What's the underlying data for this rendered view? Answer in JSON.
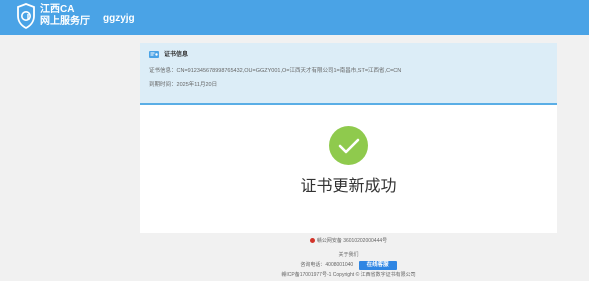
{
  "header": {
    "brand_line1": "江西CA",
    "brand_line2": "网上服务厅",
    "username": "ggzyjg"
  },
  "cert_info": {
    "title": "证书信息",
    "subject_label": "证书信息：",
    "subject_value": "CN=91234567899876543​2,OU=GGZY001,O=江西天才有限公司1=南昌市,ST=江西省,C=CN",
    "expiry_label": "到期时间：",
    "expiry_value": "2025年11月20日"
  },
  "result": {
    "message": "证书更新成功"
  },
  "footer": {
    "police_record": "赣公网安备 36010202000444号",
    "about": "关于我们",
    "hotline_label": "咨询电话：",
    "hotline": "4008001040",
    "online_service": "在线客服",
    "copyright": "赣ICP备17001977号-1   Copyright © 江西省数字证书有限公司"
  },
  "colors": {
    "header_bg": "#4aa3e6",
    "success_green": "#8fca4d",
    "button_blue": "#2f86e3"
  }
}
